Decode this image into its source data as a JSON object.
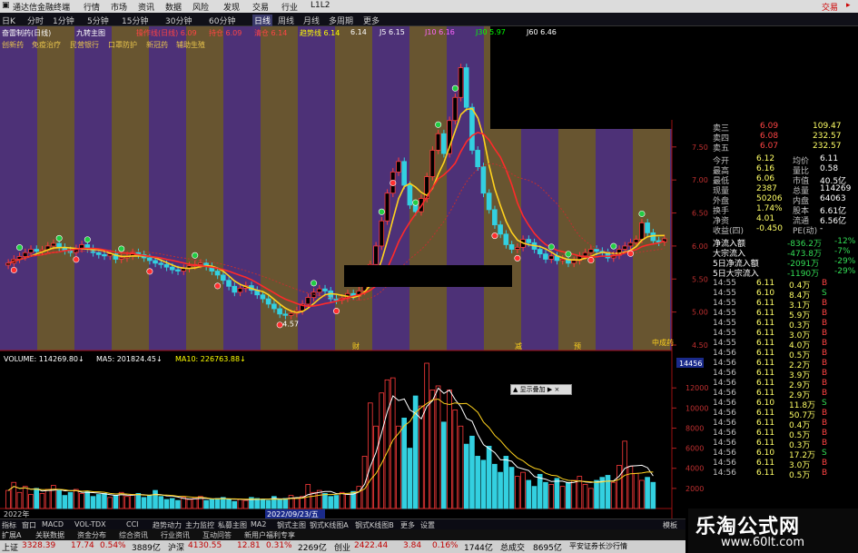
{
  "titlebar": {
    "app_name": "通达信金融终端",
    "menus": [
      "行情",
      "市场",
      "资讯",
      "数据",
      "风险",
      "发现",
      "交易",
      "行业",
      "L1L2"
    ],
    "right_label": "交易",
    "right_label_color": "#cc0000"
  },
  "periodbar": {
    "items": [
      "日K",
      "分时",
      "1分钟",
      "5分钟",
      "15分钟",
      "30分钟",
      "60分钟",
      "日线",
      "周线",
      "月线",
      "多周期",
      "更多"
    ],
    "active_index": 7
  },
  "ma_line": {
    "stock_name": "奋雷制药(日线)",
    "indicator": "九转主图",
    "items": [
      {
        "text": "操作线(日线) 6.09",
        "color": "#ff4444"
      },
      {
        "text": "持仓 6.09",
        "color": "#ff4444"
      },
      {
        "text": "清仓 6.14",
        "color": "#ff4444"
      },
      {
        "text": "趋势线 6.14",
        "color": "#ffff00"
      },
      {
        "text": "6.14",
        "color": "#ffffff"
      },
      {
        "text": "J5 6.15",
        "color": "#ffffff"
      },
      {
        "text": "J10 6.16",
        "color": "#ff66ff"
      },
      {
        "text": "J30 5.97",
        "color": "#00ff00"
      },
      {
        "text": "J60 6.46",
        "color": "#ffffff"
      }
    ]
  },
  "chip_line": {
    "items": [
      "创新药",
      "免疫治疗",
      "民营银行",
      "口罩防护",
      "新冠药",
      "辅助生殖"
    ]
  },
  "price_axis": {
    "ticks": [
      "7.50",
      "7.00",
      "6.50",
      "6.00",
      "5.50",
      "5.00",
      "4.50"
    ]
  },
  "volume_axis": {
    "ticks": [
      "12000",
      "10000",
      "8000",
      "6000",
      "4000",
      "2000"
    ],
    "highlight": "14456"
  },
  "annotations": {
    "low_label": "4.57",
    "date_label": "2022/09/23/五",
    "year_label": "2022年",
    "marks": [
      "财",
      "减",
      "预",
      "中成药"
    ]
  },
  "volume_header": {
    "items": [
      {
        "text": "VOLUME: 114269.80↓",
        "color": "#ffffff"
      },
      {
        "text": "MA5: 201824.45↓",
        "color": "#ffffff"
      },
      {
        "text": "MA10: 226763.88↓",
        "color": "#ffff00"
      }
    ]
  },
  "popup": {
    "text": "▲ 显示叠加 ▶ ×"
  },
  "quote": {
    "orderbook": [
      {
        "label": "卖三",
        "price": "6.09",
        "vol": "109.47"
      },
      {
        "label": "卖四",
        "price": "6.08",
        "vol": "232.57"
      },
      {
        "label": "卖五",
        "price": "6.07",
        "vol": "232.57"
      }
    ],
    "stats": [
      {
        "l1": "今开",
        "v1": "6.12",
        "l2": "均价",
        "v2": "6.11"
      },
      {
        "l1": "最高",
        "v1": "6.16",
        "l2": "量比",
        "v2": "0.58"
      },
      {
        "l1": "最低",
        "v1": "6.06",
        "l2": "市值",
        "v2": "40.5亿"
      },
      {
        "l1": "现量",
        "v1": "2387",
        "l2": "总量",
        "v2": "114269"
      },
      {
        "l1": "外盘",
        "v1": "50206",
        "l2": "内盘",
        "v2": "64063"
      },
      {
        "l1": "换手",
        "v1": "1.74%",
        "l2": "股本",
        "v2": "6.61亿"
      },
      {
        "l1": "净资",
        "v1": "4.01",
        "l2": "流通",
        "v2": "6.56亿"
      },
      {
        "l1": "收益(四)",
        "v1": "-0.450",
        "l2": "PE(动)",
        "v2": "-"
      }
    ],
    "flows": [
      {
        "label": "净流入额",
        "value": "-836.2万",
        "pct": "-12%"
      },
      {
        "label": "大宗流入",
        "value": "-473.8万",
        "pct": "-7%"
      },
      {
        "label": "5日净流入额",
        "value": "-2091万",
        "pct": "-29%"
      },
      {
        "label": "5日大宗流入",
        "value": "-1190万",
        "pct": "-29%"
      }
    ],
    "ticks": [
      {
        "time": "14:55",
        "price": "6.11",
        "vol": "0.4万",
        "bs": "B"
      },
      {
        "time": "14:55",
        "price": "6.10",
        "vol": "8.4万",
        "bs": "S"
      },
      {
        "time": "14:55",
        "price": "6.11",
        "vol": "3.1万",
        "bs": "B"
      },
      {
        "time": "14:55",
        "price": "6.11",
        "vol": "5.9万",
        "bs": "B"
      },
      {
        "time": "14:55",
        "price": "6.11",
        "vol": "0.3万",
        "bs": "B"
      },
      {
        "time": "14:55",
        "price": "6.11",
        "vol": "3.0万",
        "bs": "B"
      },
      {
        "time": "14:55",
        "price": "6.11",
        "vol": "4.0万",
        "bs": "B"
      },
      {
        "time": "14:56",
        "price": "6.11",
        "vol": "0.5万",
        "bs": "B"
      },
      {
        "time": "14:56",
        "price": "6.11",
        "vol": "2.2万",
        "bs": "B"
      },
      {
        "time": "14:56",
        "price": "6.11",
        "vol": "3.9万",
        "bs": "B"
      },
      {
        "time": "14:56",
        "price": "6.11",
        "vol": "2.9万",
        "bs": "B"
      },
      {
        "time": "14:56",
        "price": "6.11",
        "vol": "2.9万",
        "bs": "B"
      },
      {
        "time": "14:56",
        "price": "6.10",
        "vol": "11.8万",
        "bs": "S"
      },
      {
        "time": "14:56",
        "price": "6.11",
        "vol": "50.7万",
        "bs": "B"
      },
      {
        "time": "14:56",
        "price": "6.11",
        "vol": "0.4万",
        "bs": "B"
      },
      {
        "time": "14:56",
        "price": "6.11",
        "vol": "0.5万",
        "bs": "B"
      },
      {
        "time": "14:56",
        "price": "6.11",
        "vol": "0.3万",
        "bs": "B"
      },
      {
        "time": "14:56",
        "price": "6.10",
        "vol": "17.2万",
        "bs": "S"
      },
      {
        "time": "14:56",
        "price": "6.11",
        "vol": "3.0万",
        "bs": "B"
      },
      {
        "time": "14:56",
        "price": "6.11",
        "vol": "0.5万",
        "bs": "B"
      }
    ]
  },
  "bottom_tabs": {
    "items": [
      "指标",
      "窗口",
      "MACD",
      "VOL-TDX",
      "CCI",
      "趋势动力",
      "主力监控",
      "私募主图",
      "MA2",
      "钢式主图",
      "钢式K线图A",
      "钢式K线图B",
      "更多",
      "设置"
    ],
    "right": "模板"
  },
  "bottom_tabs2": {
    "items": [
      "扩展A",
      "关联数据",
      "资金分布",
      "综合资讯",
      "行业资讯",
      "互动问答",
      "新用户福利专享"
    ]
  },
  "index_bar": {
    "items": [
      {
        "name": "上证",
        "value": "3328.39",
        "chg": "17.74",
        "pct": "0.54%",
        "amt": "3889亿"
      },
      {
        "name": "沪深",
        "value": "4130.55",
        "chg": "12.81",
        "pct": "0.31%",
        "amt": "2269亿"
      },
      {
        "name": "创业",
        "value": "2422.44",
        "chg": "3.84",
        "pct": "0.16%",
        "amt": "1744亿"
      }
    ],
    "total_label": "总成交",
    "total_value": "8695亿",
    "server": "平安证券长沙行情"
  },
  "watermark": {
    "title": "乐淘公式网",
    "url": "www.60lt.com"
  },
  "chart_data": {
    "type": "candlestick",
    "price_range": [
      4.5,
      7.9
    ],
    "close": [
      5.74,
      5.8,
      5.84,
      5.9,
      5.95,
      5.92,
      5.94,
      6.0,
      6.04,
      5.98,
      5.93,
      5.9,
      5.96,
      6.02,
      5.96,
      5.9,
      5.87,
      5.85,
      5.88,
      5.8,
      5.82,
      5.85,
      5.9,
      5.87,
      5.82,
      5.78,
      5.74,
      5.72,
      5.68,
      5.64,
      5.62,
      5.66,
      5.7,
      5.72,
      5.74,
      5.69,
      5.62,
      5.56,
      5.48,
      5.39,
      5.3,
      5.36,
      5.4,
      5.33,
      5.26,
      5.2,
      5.12,
      5.05,
      4.97,
      4.95,
      4.98,
      5.02,
      5.12,
      5.22,
      5.3,
      5.35,
      5.32,
      5.2,
      5.18,
      5.21,
      5.28,
      5.24,
      5.32,
      5.48,
      5.72,
      6.0,
      6.38,
      6.8,
      7.12,
      7.28,
      6.92,
      6.62,
      6.52,
      6.72,
      7.05,
      7.45,
      7.7,
      7.4,
      7.9,
      8.25,
      8.7,
      8.1,
      7.45,
      7.2,
      6.8,
      6.55,
      6.32,
      6.18,
      6.02,
      5.95,
      5.98,
      6.1,
      6.05,
      5.95,
      5.88,
      5.8,
      5.85,
      5.78,
      5.8,
      5.74,
      5.78,
      5.85,
      5.9,
      5.95,
      5.92,
      5.9,
      5.82,
      5.86,
      5.95,
      6.0,
      6.05,
      6.1,
      6.35,
      6.2,
      6.08,
      6.06,
      6.11
    ],
    "volume_scale": [
      0,
      14456
    ],
    "volume": [
      1800,
      2600,
      1600,
      2200,
      1400,
      2000,
      1500,
      1900,
      2300,
      1800,
      1300,
      1600,
      1900,
      1500,
      1700,
      1200,
      1400,
      1500,
      1100,
      1300,
      1600,
      1200,
      1400,
      1500,
      1100,
      1300,
      1800,
      1200,
      900,
      1000,
      800,
      1100,
      900,
      1000,
      1200,
      800,
      900,
      1000,
      1100,
      900,
      700,
      900,
      800,
      1100,
      1000,
      900,
      800,
      1200,
      900,
      1000,
      1300,
      1000,
      1200,
      2400,
      1600,
      1800,
      1500,
      1200,
      1300,
      1600,
      1400,
      1700,
      2200,
      5200,
      10500,
      8200,
      11500,
      12800,
      13000,
      8200,
      9000,
      6000,
      11200,
      10200,
      14456,
      11800,
      12200,
      8600,
      11800,
      9800,
      8200,
      6400,
      7200,
      5200,
      4800,
      6200,
      4400,
      3600,
      5200,
      4100,
      3200,
      3600,
      2800,
      2200,
      3400,
      2600,
      2400,
      3000,
      2200,
      2600,
      2800,
      3200,
      2400,
      2000,
      2800,
      3100,
      3300,
      2600,
      4300,
      6700,
      4200,
      3500,
      2800,
      3100,
      2600
    ]
  }
}
